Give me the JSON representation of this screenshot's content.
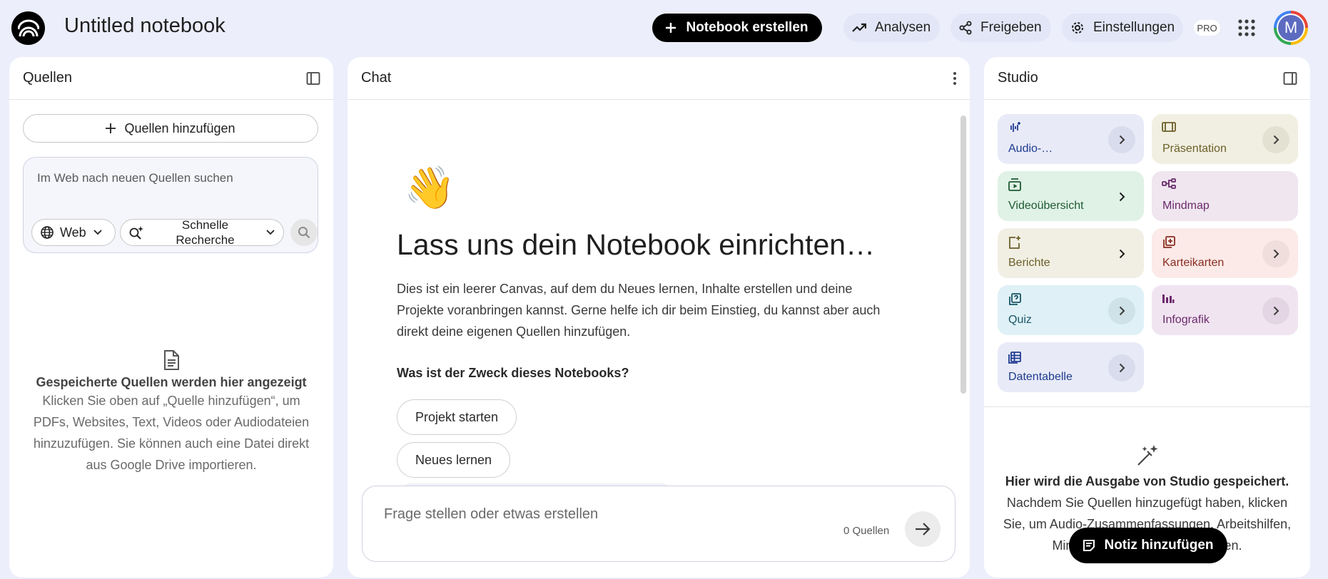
{
  "topbar": {
    "title": "Untitled notebook",
    "create_label": "Notebook erstellen",
    "analysen_label": "Analysen",
    "share_label": "Freigeben",
    "settings_label": "Einstellungen",
    "pro_badge": "PRO",
    "avatar_letter": "M"
  },
  "sources": {
    "header": "Quellen",
    "add_label": "Quellen hinzufügen",
    "search_placeholder": "Im Web nach neuen Quellen suchen",
    "web_label": "Web",
    "research_line1": "Schnelle",
    "research_line2": "Recherche",
    "empty_title": "Gespeicherte Quellen werden hier angezeigt",
    "empty_text": "Klicken Sie oben auf „Quelle hinzufügen“, um PDFs, Websites, Text, Videos oder Audiodateien hinzuzufügen. Sie können auch eine Datei direkt aus Google Drive importieren."
  },
  "chat": {
    "header": "Chat",
    "wave": "👋",
    "heading": "Lass uns dein Notebook einrichten…",
    "intro": "Dies ist ein leerer Canvas, auf dem du Neues lernen, Inhalte erstellen und deine Projekte voranbringen kannst. Gerne helfe ich dir beim Einstieg, du kannst aber auch direkt deine eigenen Quellen hinzufügen.",
    "question": "Was ist der Zweck dieses Notebooks?",
    "suggestions": [
      "Projekt starten",
      "Neues lernen"
    ],
    "composer_placeholder": "Frage stellen oder etwas erstellen",
    "source_count": "0 Quellen"
  },
  "studio": {
    "header": "Studio",
    "tiles": [
      {
        "label": "Audio-…",
        "icon": "audio-waveform-icon"
      },
      {
        "label": "Präsentation",
        "icon": "presentation-icon"
      },
      {
        "label": "Videoübersicht",
        "icon": "video-icon"
      },
      {
        "label": "Mindmap",
        "icon": "mindmap-icon"
      },
      {
        "label": "Berichte",
        "icon": "report-icon"
      },
      {
        "label": "Karteikarten",
        "icon": "flashcards-icon"
      },
      {
        "label": "Quiz",
        "icon": "quiz-icon"
      },
      {
        "label": "Infografik",
        "icon": "infographic-icon"
      },
      {
        "label": "Datentabelle",
        "icon": "data-table-icon"
      }
    ],
    "empty_title": "Hier wird die Ausgabe von Studio gespeichert.",
    "empty_text": "Nachdem Sie Quellen hinzugefügt haben, klicken Sie, um Audio-Zusammenfassungen, Arbeitshilfen, Mindmaps und mehr zu erstellen.",
    "note_label": "Notiz hinzufügen"
  }
}
